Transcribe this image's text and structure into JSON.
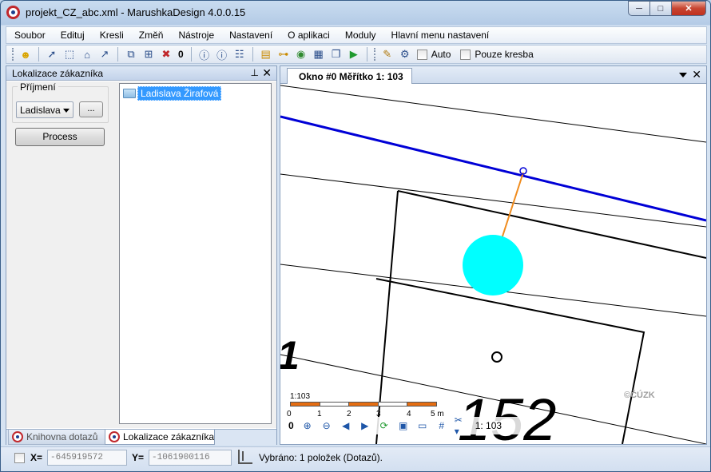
{
  "window": {
    "title": "projekt_CZ_abc.xml - MarushkaDesign 4.0.0.15",
    "minimize_label": "─",
    "maximize_label": "□",
    "close_label": "✕"
  },
  "menu": {
    "items": [
      "Soubor",
      "Edituj",
      "Kresli",
      "Změň",
      "Nástroje",
      "Nastavení",
      "O aplikaci",
      "Moduly",
      "Hlavní menu nastavení"
    ]
  },
  "toolbar": {
    "counter": "0",
    "auto_label": "Auto",
    "pouze_kresba_label": "Pouze kresba"
  },
  "left_panel": {
    "title": "Lokalizace zákazníka",
    "pin_glyph": "📌",
    "close_glyph": "✕",
    "group_label": "Příjmení",
    "combo_value": "Ladislava",
    "dots_label": "...",
    "process_label": "Process",
    "tree_item": "Ladislava Žirafová",
    "tabs": [
      "Knihovna dotazů",
      "Lokalizace zákazníka"
    ]
  },
  "map": {
    "tab_label": "Okno #0 Měřítko 1:   103",
    "close_glyph": "✕",
    "parcel_number_left": "1",
    "parcel_number_right": "152",
    "copyright": "©ČÚZK",
    "scale_label": "1:103",
    "scale_ticks": [
      "0",
      "1",
      "2",
      "3",
      "4",
      "5 m"
    ],
    "toolbar_zero": "0",
    "toolbar_scale": "1:   103",
    "colors": {
      "line_blue": "#0000d6",
      "line_orange": "#f08c1e",
      "circle_cyan": "#00ffff"
    }
  },
  "status": {
    "x_label": "X=",
    "x_value": "-645919572",
    "y_label": "Y=",
    "y_value": "-1061900116",
    "message": "Vybráno: 1  položek (Dotazů)."
  }
}
